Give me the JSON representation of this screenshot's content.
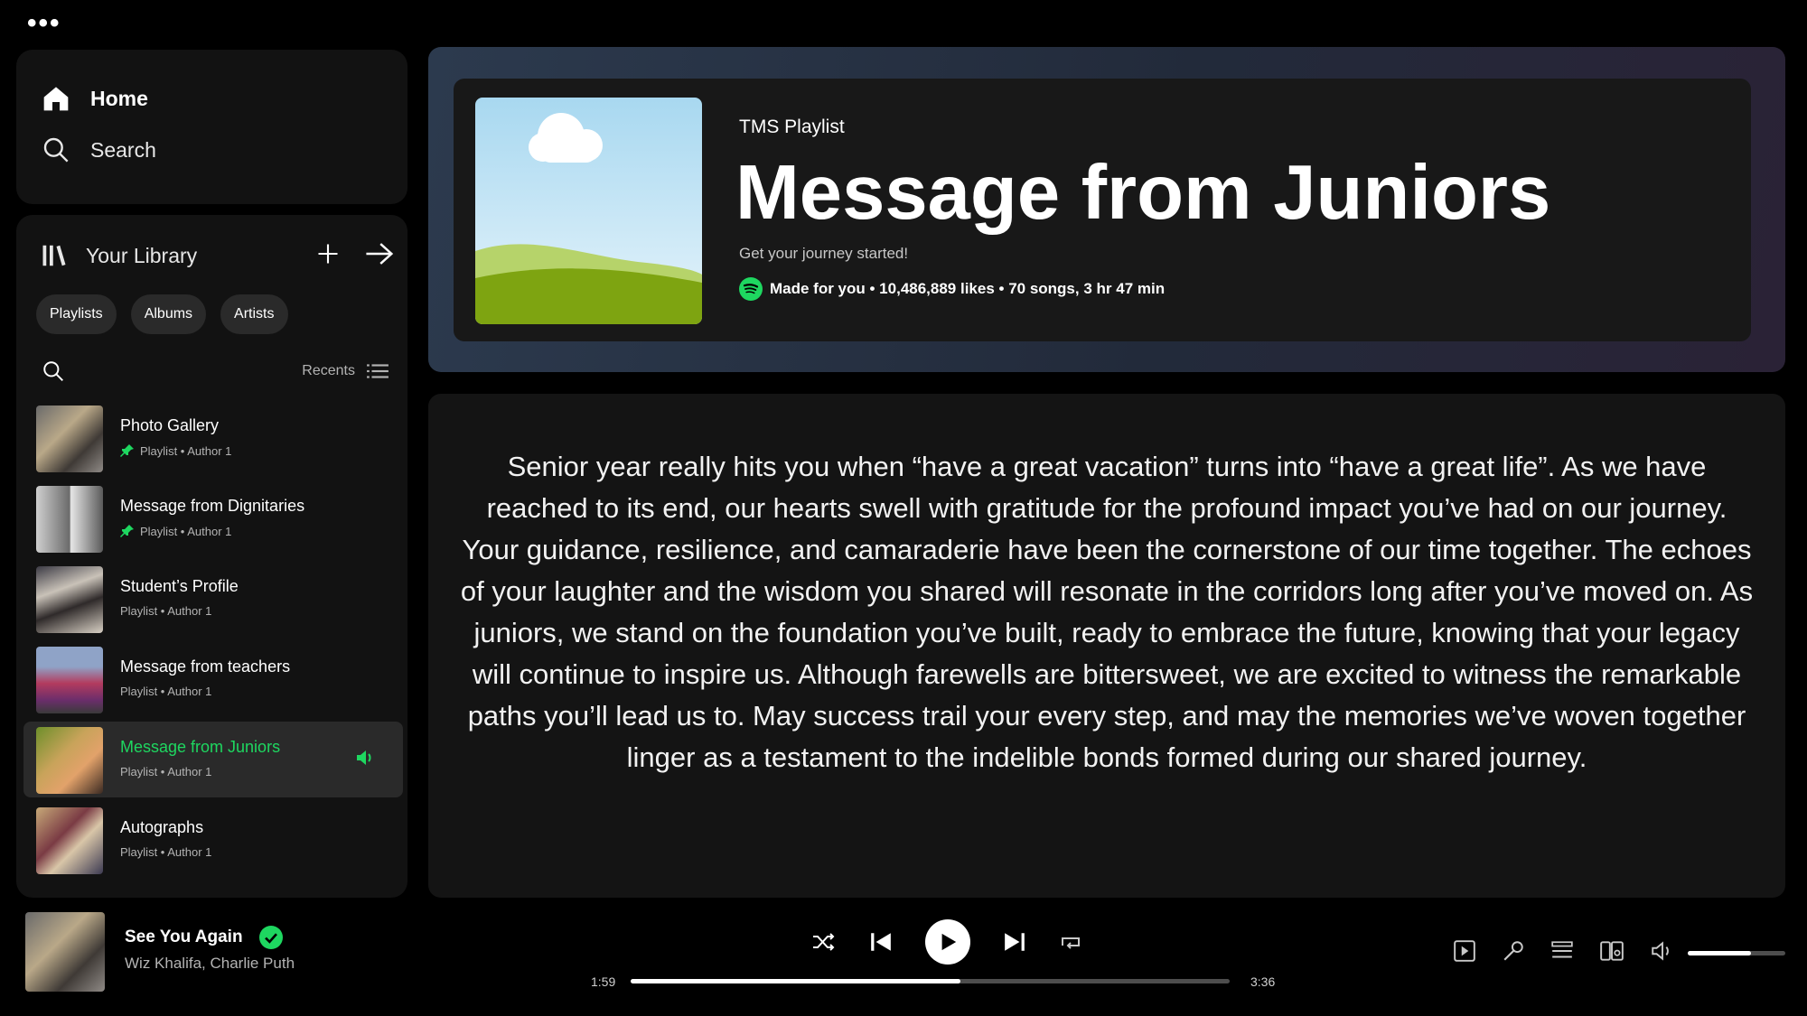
{
  "window": {
    "menu_glyph": "•••"
  },
  "nav": {
    "home": "Home",
    "search": "Search"
  },
  "library": {
    "title": "Your Library",
    "chips": [
      "Playlists",
      "Albums",
      "Artists"
    ],
    "sort_label": "Recents",
    "items": [
      {
        "title": "Photo Gallery",
        "subtitle": "Playlist • Author 1",
        "pinned": true,
        "active": false
      },
      {
        "title": "Message from Dignitaries",
        "subtitle": "Playlist • Author 1",
        "pinned": true,
        "active": false
      },
      {
        "title": "Student’s Profile",
        "subtitle": "Playlist • Author 1",
        "pinned": false,
        "active": false
      },
      {
        "title": "Message from teachers",
        "subtitle": "Playlist • Author 1",
        "pinned": false,
        "active": false
      },
      {
        "title": "Message from Juniors",
        "subtitle": "Playlist • Author 1",
        "pinned": false,
        "active": true
      },
      {
        "title": "Autographs",
        "subtitle": "Playlist • Author 1",
        "pinned": false,
        "active": false
      }
    ]
  },
  "playlist": {
    "kind": "TMS Playlist",
    "title": "Message from Juniors",
    "description": "Get your journey started!",
    "meta": "Made for you • 10,486,889 likes • 70 songs, 3 hr 47 min"
  },
  "message": {
    "text": "Senior year really hits you when “have a great vacation” turns into “have a great life”. As we have reached to its end, our hearts swell with gratitude for the profound impact you’ve had on our journey. Your guidance, resilience, and camaraderie have been the cornerstone of our time together. The echoes of your laughter and the wisdom you shared will resonate in the corridors long after you’ve moved on. As juniors, we stand on the foundation you’ve built, ready to embrace the future, knowing that your legacy will continue to inspire us. Although farewells are bittersweet, we are excited to witness the remarkable paths you’ll lead us to. May success trail your every step, and may the memories we’ve woven together linger as a testament to the indelible bonds formed during our shared journey."
  },
  "now_playing": {
    "title": "See You Again",
    "artist": "Wiz Khalifa, Charlie Puth",
    "elapsed": "1:59",
    "duration": "3:36",
    "progress": 0.55,
    "volume": 0.65
  },
  "colors": {
    "accent": "#1ed760",
    "background": "#000000",
    "panel": "#121212"
  }
}
